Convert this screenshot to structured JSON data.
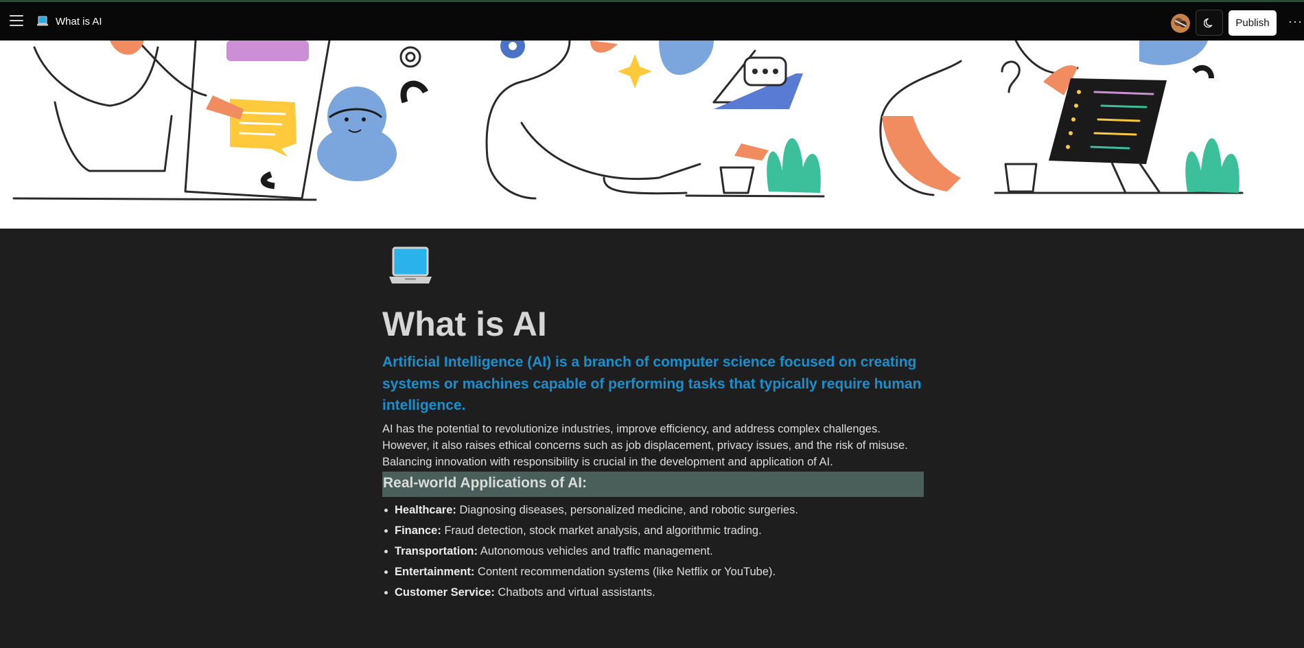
{
  "header": {
    "page_title": "What is AI",
    "publish_label": "Publish",
    "more_label": "···"
  },
  "page": {
    "title": "What is AI",
    "lead": "Artificial Intelligence (AI) is a branch of computer science focused on creating systems or machines capable of performing tasks that typically require human intelligence.",
    "paragraph": "AI has the potential to revolutionize industries, improve efficiency, and address complex challenges. However, it also raises ethical concerns such as job displacement, privacy issues, and the risk of misuse. Balancing innovation with responsibility is crucial in the development and application of AI.",
    "section_heading": "Real-world Applications of AI:",
    "applications": [
      {
        "term": "Healthcare:",
        "desc": " Diagnosing diseases, personalized medicine, and robotic surgeries."
      },
      {
        "term": "Finance:",
        "desc": " Fraud detection, stock market analysis, and algorithmic trading."
      },
      {
        "term": "Transportation:",
        "desc": " Autonomous vehicles and traffic management."
      },
      {
        "term": "Entertainment:",
        "desc": " Content recommendation systems (like Netflix or YouTube)."
      },
      {
        "term": "Customer Service:",
        "desc": " Chatbots and virtual assistants."
      }
    ]
  },
  "icons": {
    "menu": "hamburger-menu-icon",
    "page": "laptop-icon",
    "theme": "moon-icon",
    "more": "more-horizontal-icon"
  },
  "colors": {
    "lead_text": "#1a8fce",
    "heading_highlight": "#4a5f5a",
    "background": "#1e1e1e",
    "topbar": "#080808"
  }
}
